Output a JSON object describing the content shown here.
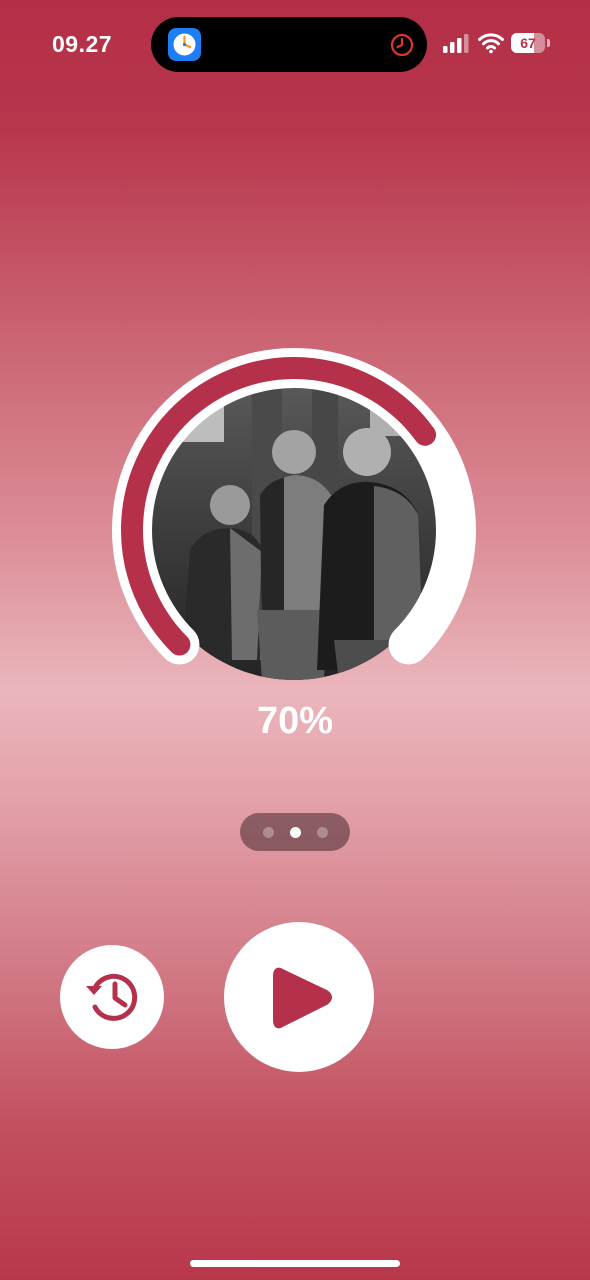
{
  "status_bar": {
    "time": "09.27",
    "battery_level": "67",
    "battery_fraction": 0.67,
    "signal_bars": 3,
    "island_app_icon": "clock-app-icon",
    "island_activity_icon": "timer-icon"
  },
  "player": {
    "progress_percent": 70,
    "progress_label": "70%",
    "artwork": "black-and-white-group-photo"
  },
  "pager": {
    "count": 3,
    "active_index": 1
  },
  "controls": {
    "history_icon": "history-icon",
    "play_icon": "play-icon"
  },
  "colors": {
    "accent": "#b5304a",
    "ring_track": "#ffffff",
    "ring_fill": "#b5304a",
    "background_top": "#b32f47",
    "background_middle": "#eab6bc"
  }
}
